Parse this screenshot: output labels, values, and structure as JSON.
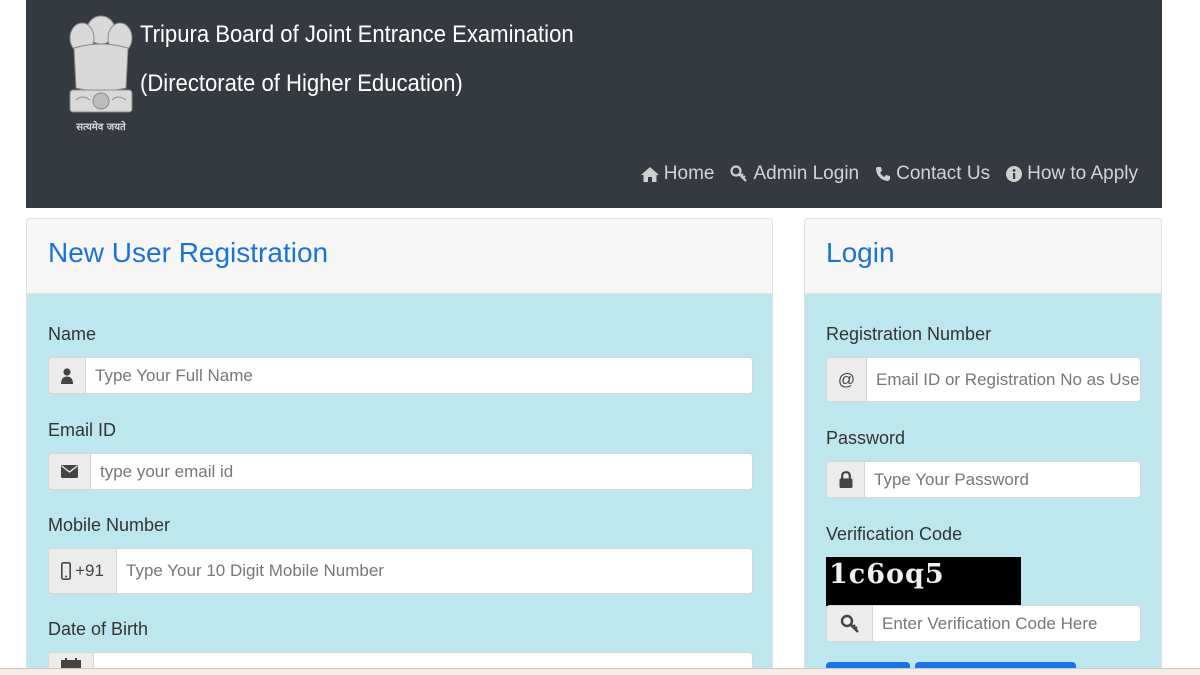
{
  "header": {
    "title_line1": "Tripura Board of Joint Entrance Examination",
    "title_line2": "(Directorate of Higher Education)",
    "motto": "सत्यमेव जयते",
    "emblem_icon": "national-emblem-icon",
    "background": "#343a40"
  },
  "nav": [
    {
      "label": "Home",
      "icon": "home-icon"
    },
    {
      "label": "Admin Login",
      "icon": "key-icon"
    },
    {
      "label": "Contact Us",
      "icon": "phone-icon"
    },
    {
      "label": "How to Apply",
      "icon": "info-icon"
    }
  ],
  "registration": {
    "title": "New User Registration",
    "name": {
      "label": "Name",
      "placeholder": "Type Your Full Name",
      "icon": "user-icon"
    },
    "email": {
      "label": "Email ID",
      "placeholder": "type your email id",
      "icon": "envelope-icon"
    },
    "mobile": {
      "label": "Mobile Number",
      "prefix": "+91",
      "placeholder": "Type Your 10 Digit Mobile Number",
      "icon": "mobile-icon"
    },
    "dob": {
      "label": "Date of Birth",
      "icon": "calendar-icon"
    }
  },
  "login": {
    "title": "Login",
    "regno": {
      "label": "Registration Number",
      "addon": "@",
      "placeholder": "Email ID or Registration No as User ID"
    },
    "password": {
      "label": "Password",
      "placeholder": "Type Your Password",
      "icon": "lock-icon"
    },
    "verification": {
      "label": "Verification Code",
      "captcha": "1c6oq5",
      "placeholder": "Enter Verification Code Here",
      "icon": "key-icon"
    }
  },
  "colors": {
    "accent": "#1a73d9",
    "panel": "#bde6ef",
    "button": "#1a73e8"
  }
}
